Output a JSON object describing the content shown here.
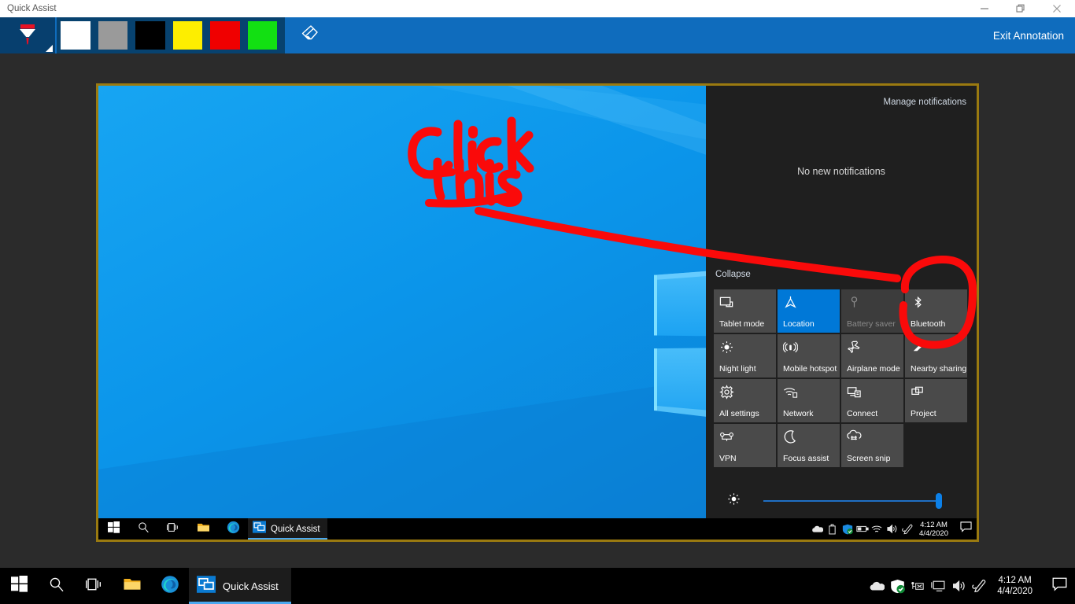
{
  "window": {
    "title": "Quick Assist",
    "controls": [
      {
        "name": "minimize",
        "glyph": "minimize-icon"
      },
      {
        "name": "restore",
        "glyph": "restore-icon"
      },
      {
        "name": "close",
        "glyph": "close-icon"
      }
    ]
  },
  "annotation_toolbar": {
    "pen_tool": {
      "icon": "highlighter-pen-icon",
      "selected": true,
      "tip_color": "#e81123"
    },
    "swatches": [
      {
        "name": "white",
        "hex": "#ffffff"
      },
      {
        "name": "gray",
        "hex": "#9a9a9a"
      },
      {
        "name": "black",
        "hex": "#000000"
      },
      {
        "name": "yellow",
        "hex": "#fdee00"
      },
      {
        "name": "red",
        "hex": "#f00000"
      },
      {
        "name": "green",
        "hex": "#12e012"
      }
    ],
    "eraser": {
      "icon": "eraser-icon"
    },
    "exit_label": "Exit Annotation",
    "toolbar_bg": "#0f6cbd",
    "selected_bg": "#073f6e"
  },
  "shared_screen": {
    "border_color": "#9a7a10",
    "wallpaper": "windows-10-blue-hero"
  },
  "action_center": {
    "manage_notifications": "Manage notifications",
    "empty_message": "No new notifications",
    "collapse": "Collapse",
    "accent_color": "#0078d7",
    "tiles": [
      {
        "label": "Tablet mode",
        "icon": "tablet-mode-icon",
        "state": "normal"
      },
      {
        "label": "Location",
        "icon": "location-icon",
        "state": "active"
      },
      {
        "label": "Battery saver",
        "icon": "battery-saver-icon",
        "state": "disabled"
      },
      {
        "label": "Bluetooth",
        "icon": "bluetooth-icon",
        "state": "normal"
      },
      {
        "label": "Night light",
        "icon": "night-light-icon",
        "state": "normal"
      },
      {
        "label": "Mobile hotspot",
        "icon": "mobile-hotspot-icon",
        "state": "normal"
      },
      {
        "label": "Airplane mode",
        "icon": "airplane-mode-icon",
        "state": "normal"
      },
      {
        "label": "Nearby sharing",
        "icon": "nearby-sharing-icon",
        "state": "normal"
      },
      {
        "label": "All settings",
        "icon": "gear-icon",
        "state": "normal"
      },
      {
        "label": "Network",
        "icon": "network-wifi-icon",
        "state": "normal"
      },
      {
        "label": "Connect",
        "icon": "connect-icon",
        "state": "normal"
      },
      {
        "label": "Project",
        "icon": "project-icon",
        "state": "normal"
      },
      {
        "label": "VPN",
        "icon": "vpn-icon",
        "state": "normal"
      },
      {
        "label": "Focus assist",
        "icon": "moon-icon",
        "state": "normal"
      },
      {
        "label": "Screen snip",
        "icon": "screen-snip-icon",
        "state": "normal"
      },
      {
        "label": "",
        "icon": "",
        "state": "empty"
      }
    ],
    "brightness": {
      "icon": "brightness-icon",
      "value": 100
    }
  },
  "inner_taskbar": {
    "items": [
      {
        "name": "start-button",
        "icon": "windows-logo-icon"
      },
      {
        "name": "search-button",
        "icon": "search-icon"
      },
      {
        "name": "task-view-button",
        "icon": "task-view-icon"
      },
      {
        "name": "file-explorer",
        "icon": "file-explorer-icon"
      },
      {
        "name": "edge-browser",
        "icon": "edge-icon"
      }
    ],
    "app_button": {
      "label": "Quick Assist",
      "icon": "quick-assist-icon",
      "active": true
    },
    "tray": [
      {
        "name": "onedrive-icon"
      },
      {
        "name": "usb-eject-icon"
      },
      {
        "name": "windows-security-icon"
      },
      {
        "name": "battery-icon"
      },
      {
        "name": "wifi-icon"
      },
      {
        "name": "volume-icon"
      },
      {
        "name": "pen-workspace-icon"
      }
    ],
    "clock": {
      "time": "4:12 AM",
      "date": "4/4/2020"
    },
    "action_center_button": "action-center-icon"
  },
  "host_taskbar": {
    "items": [
      {
        "name": "start-button",
        "icon": "windows-logo-icon"
      },
      {
        "name": "search-button",
        "icon": "search-icon"
      },
      {
        "name": "task-view-button",
        "icon": "task-view-icon"
      },
      {
        "name": "file-explorer",
        "icon": "file-explorer-icon"
      },
      {
        "name": "edge-browser",
        "icon": "edge-icon"
      }
    ],
    "app_button": {
      "label": "Quick Assist",
      "icon": "quick-assist-icon",
      "active": true
    },
    "tray": [
      {
        "name": "onedrive-icon"
      },
      {
        "name": "windows-security-icon"
      },
      {
        "name": "usb-eject-icon"
      },
      {
        "name": "display-icon"
      },
      {
        "name": "volume-icon"
      },
      {
        "name": "pen-workspace-icon"
      }
    ],
    "clock": {
      "time": "4:12 AM",
      "date": "4/4/2020"
    },
    "action_center_button": "action-center-icon"
  },
  "ink_annotations": {
    "color": "#fa0a0a",
    "stroke_width": 9,
    "texts": [
      "click",
      "this"
    ],
    "shapes": [
      "underline-stroke",
      "pointer-line",
      "circle-around-bluetooth"
    ]
  }
}
